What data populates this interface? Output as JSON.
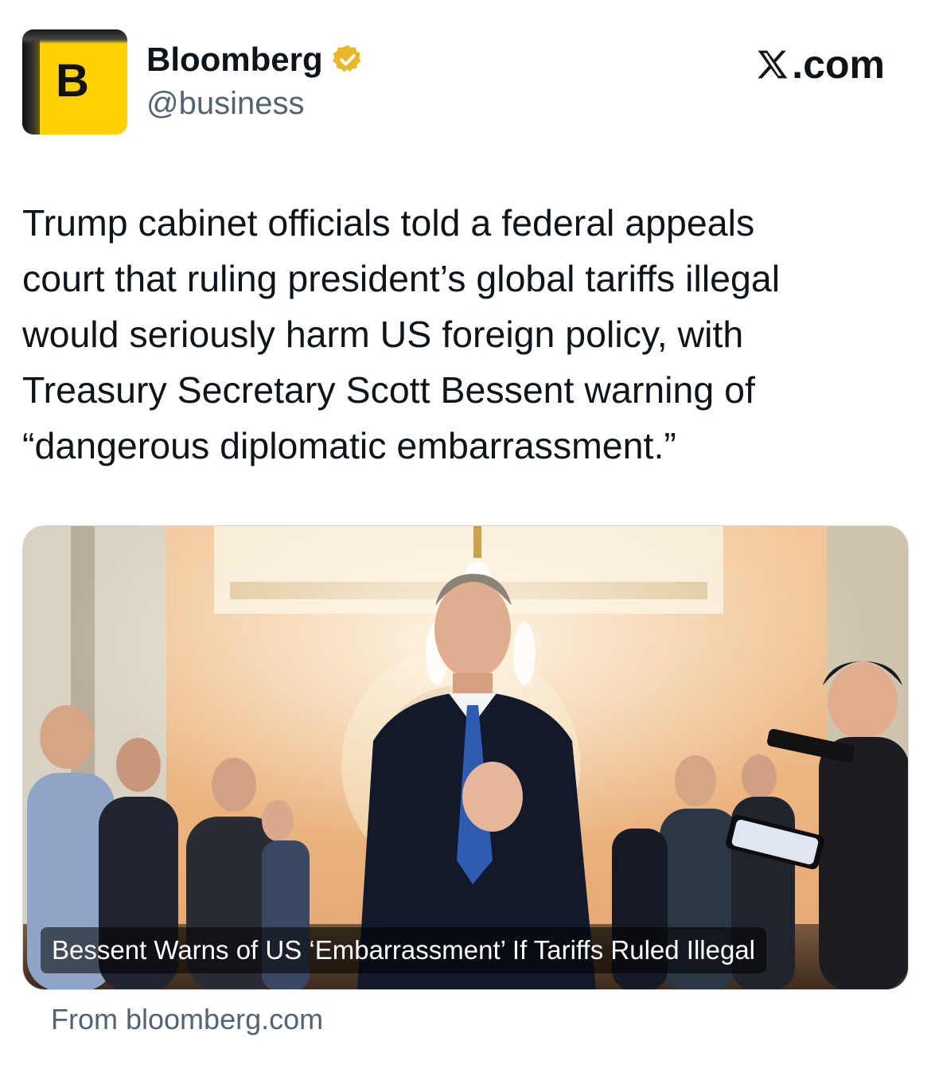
{
  "author": {
    "avatar_letter": "B",
    "name": "Bloomberg",
    "handle": "@business",
    "verified_badge": "gold-verified-icon",
    "avatar_color": "#ffd200"
  },
  "site": {
    "label": ".com",
    "logo": "x-logo-icon"
  },
  "tweet": {
    "text": "Trump cabinet officials told a federal appeals\ncourt that ruling president’s global tariffs illegal\nwould seriously harm US foreign policy, with\nTreasury Secretary Scott Bessent warning of\n“dangerous diplomatic embarrassment.”"
  },
  "card": {
    "caption": "Bessent Warns of US ‘Embarrassment’ If Tariffs Ruled Illegal",
    "source": "From bloomberg.com"
  },
  "colors": {
    "text": "#0f1419",
    "secondary": "#536471",
    "badge_gold": "#e8b829"
  }
}
